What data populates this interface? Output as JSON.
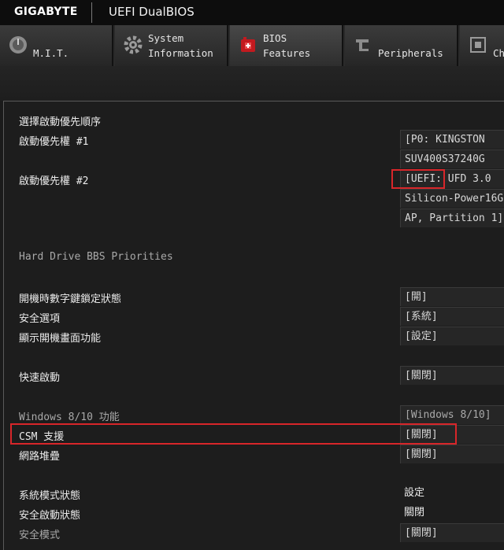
{
  "header": {
    "brand": "GIGABYTE",
    "product": "UEFI DualBIOS"
  },
  "tabs": [
    {
      "label": "M.I.T.",
      "icon": "gauge-icon"
    },
    {
      "label": "System\nInformation",
      "icon": "gear-icon"
    },
    {
      "label": "BIOS\nFeatures",
      "icon": "chip-icon"
    },
    {
      "label": "Peripherals",
      "icon": "connector-icon"
    },
    {
      "label": "Ch",
      "icon": "chipset-icon"
    }
  ],
  "settings": {
    "boot_section": "選擇啟動優先順序",
    "boot1_label": "啟動優先權 #1",
    "boot1_value_l1": "[P0: KINGSTON",
    "boot1_value_l2": "SUV400S37240G",
    "boot2_label": "啟動優先權 #2",
    "boot2_value_l1": "[UEFI: UFD 3.0",
    "boot2_value_l2": "Silicon-Power16G",
    "boot2_value_l3": "AP, Partition 1]",
    "hdd_bbs": "Hard Drive BBS Priorities",
    "numlock_label": "開機時數字鍵鎖定狀態",
    "numlock_value": "[開]",
    "security_label": "安全選項",
    "security_value": "[系統]",
    "logo_label": "顯示開機畫面功能",
    "logo_value": "[設定]",
    "fastboot_label": "快速啟動",
    "fastboot_value": "[關閉]",
    "win_label": "Windows 8/10 功能",
    "win_value": "[Windows 8/10]",
    "csm_label": "CSM 支援",
    "csm_value": "[關閉]",
    "network_label": "網路堆疊",
    "network_value": "[關閉]",
    "sysmode_label": "系統模式狀態",
    "sysmode_value": "設定",
    "secureboot_label": "安全啟動狀態",
    "secureboot_value": "關閉",
    "securemode_label": "安全模式",
    "securemode_value": "[關閉]"
  },
  "colors": {
    "highlight": "#d8262a",
    "background": "#1b1b1b"
  }
}
